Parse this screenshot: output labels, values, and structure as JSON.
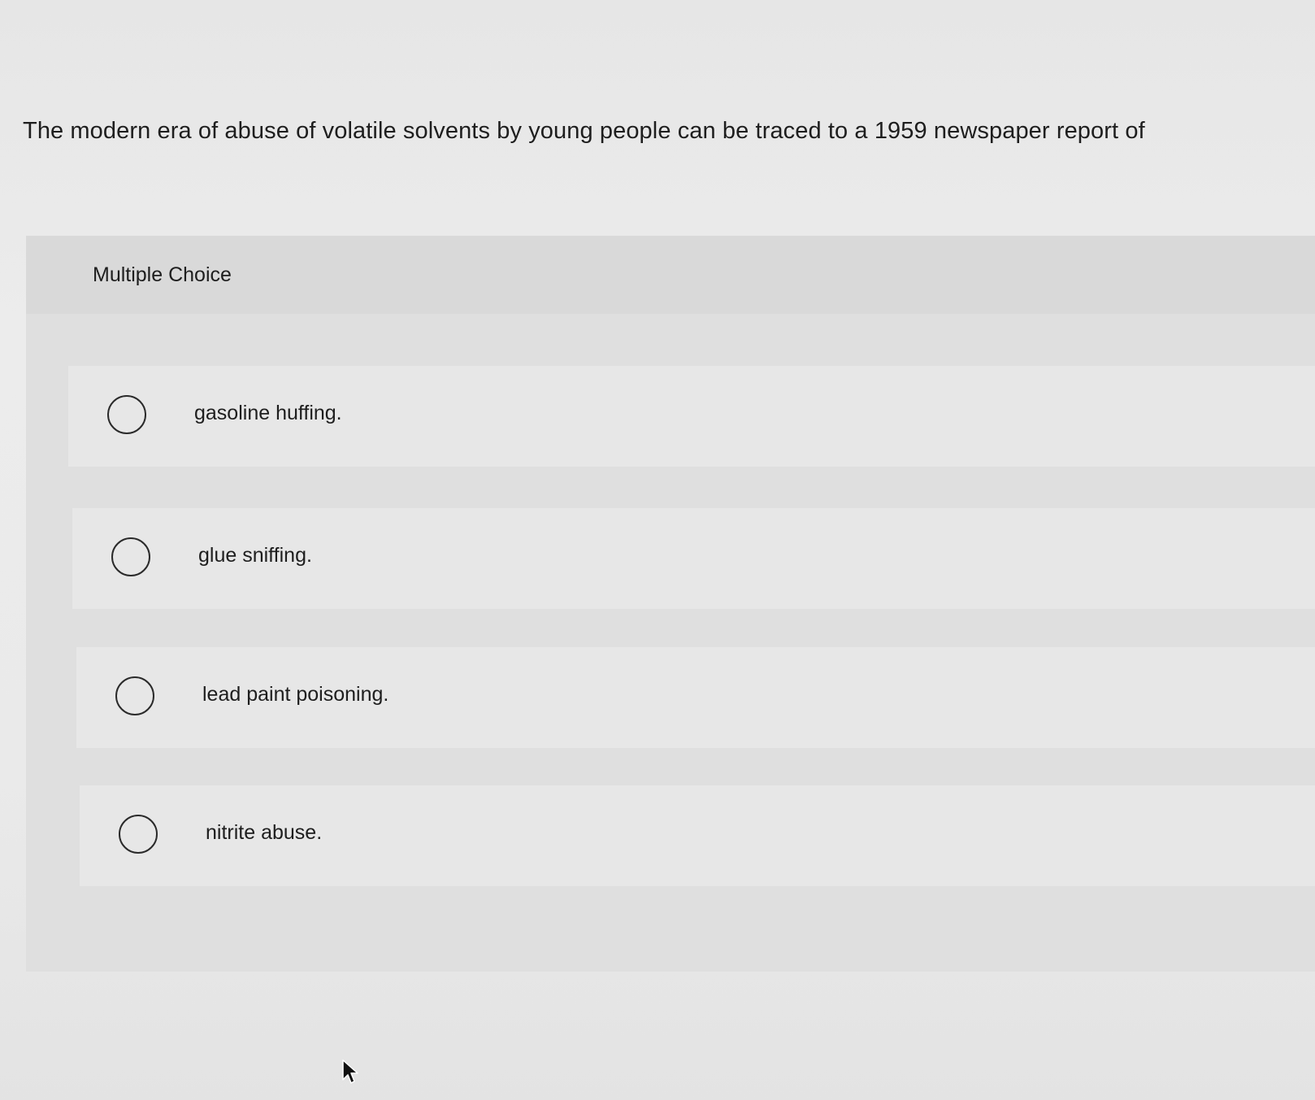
{
  "question": {
    "text": "The modern era of abuse of volatile solvents by young people can be traced to a 1959 newspaper report of"
  },
  "multiple_choice": {
    "label": "Multiple Choice",
    "options": [
      {
        "label": "gasoline huffing.",
        "selected": false
      },
      {
        "label": "glue sniffing.",
        "selected": false
      },
      {
        "label": "lead paint poisoning.",
        "selected": false
      },
      {
        "label": "nitrite abuse.",
        "selected": false
      }
    ]
  },
  "icons": {
    "radio": "radio-unselected-icon",
    "cursor": "mouse-pointer-icon"
  },
  "colors": {
    "page_background": "#eaeaea",
    "panel_background": "#dfdfdf",
    "option_background": "#e7e7e7",
    "text": "#1e1e1e",
    "radio_border": "#2a2a2a"
  }
}
